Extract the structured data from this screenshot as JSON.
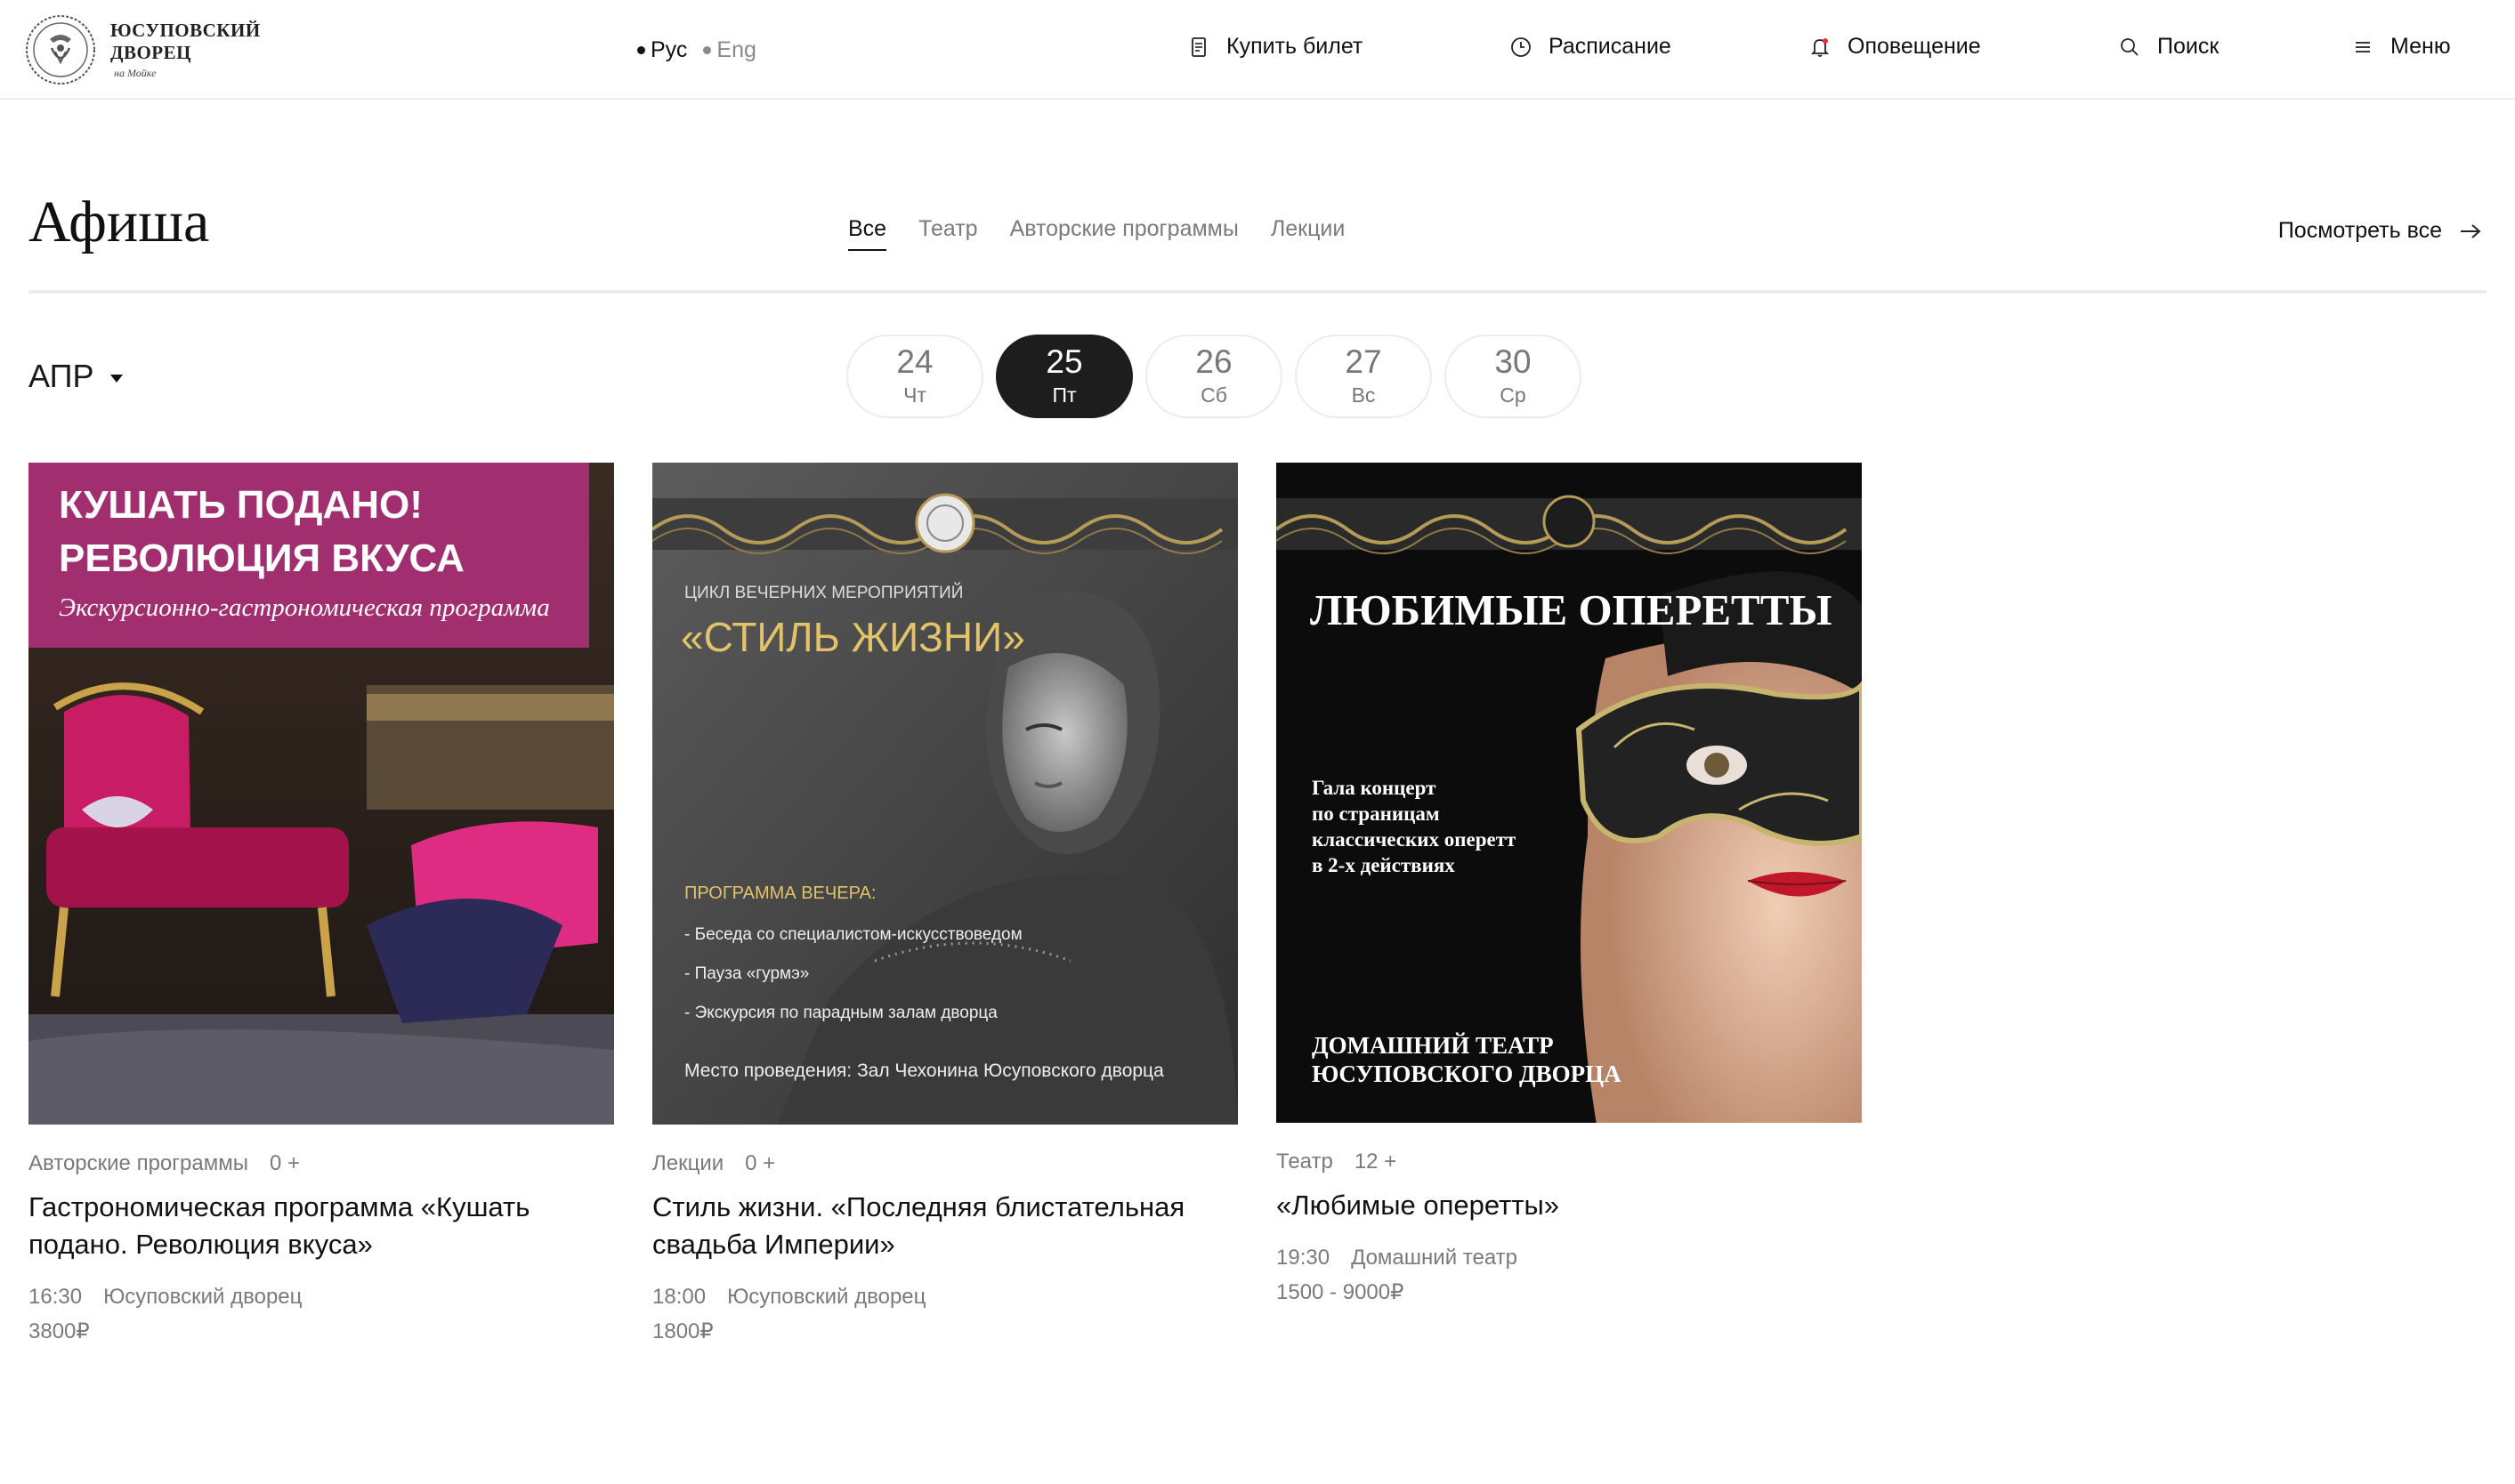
{
  "header": {
    "logo": {
      "line1": "ЮСУПОВСКИЙ",
      "line2": "ДВОРЕЦ",
      "sub": "на Мойке"
    },
    "languages": [
      {
        "label": "Рус",
        "active": true
      },
      {
        "label": "Eng",
        "active": false
      }
    ],
    "nav": [
      {
        "label": "Купить билет",
        "icon": "ticket-icon"
      },
      {
        "label": "Расписание",
        "icon": "clock-icon"
      },
      {
        "label": "Оповещение",
        "icon": "bell-icon"
      },
      {
        "label": "Поиск",
        "icon": "search-icon"
      },
      {
        "label": "Меню",
        "icon": "menu-icon"
      }
    ]
  },
  "afisha": {
    "title": "Афиша",
    "tabs": [
      {
        "label": "Все",
        "active": true
      },
      {
        "label": "Театр",
        "active": false
      },
      {
        "label": "Авторские программы",
        "active": false
      },
      {
        "label": "Лекции",
        "active": false
      }
    ],
    "view_all": "Посмотреть все"
  },
  "calendar": {
    "month": "АПР",
    "dates": [
      {
        "day": "24",
        "weekday": "Чт",
        "active": false
      },
      {
        "day": "25",
        "weekday": "Пт",
        "active": true
      },
      {
        "day": "26",
        "weekday": "Сб",
        "active": false
      },
      {
        "day": "27",
        "weekday": "Вс",
        "active": false
      },
      {
        "day": "30",
        "weekday": "Ср",
        "active": false
      }
    ]
  },
  "events": [
    {
      "category": "Авторские программы",
      "age": "0 +",
      "title": "Гастрономическая программа «Кушать подано. Революция вкуса»",
      "time": "16:30",
      "place": "Юсуповский дворец",
      "price": "3800₽",
      "poster": {
        "line1": "КУШАТЬ ПОДАНО!",
        "line2": "РЕВОЛЮЦИЯ ВКУСА",
        "line3": "Экскурсионно-гастрономическая программа"
      }
    },
    {
      "category": "Лекции",
      "age": "0 +",
      "title": "Стиль жизни. «Последняя блистательная свадьба Империи»",
      "time": "18:00",
      "place": "Юсуповский дворец",
      "price": "1800₽",
      "poster": {
        "series": "ЦИКЛ ВЕЧЕРНИХ МЕРОПРИЯТИЙ",
        "name": "«СТИЛЬ ЖИЗНИ»",
        "program_title": "ПРОГРАММА ВЕЧЕРА:",
        "items": [
          "- Беседа со специалистом-искусствоведом",
          "- Пауза «гурмэ»",
          "- Экскурсия по парадным залам дворца"
        ],
        "venue": "Место проведения: Зал Чехонина Юсуповского дворца"
      }
    },
    {
      "category": "Театр",
      "age": "12 +",
      "title": "«Любимые оперетты»",
      "time": "19:30",
      "place": "Домашний театр",
      "price": "1500 - 9000₽",
      "poster": {
        "title": "ЛЮБИМЫЕ ОПЕРЕТТЫ",
        "desc": [
          "Гала концерт",
          "по страницам",
          "классических оперетт",
          "в 2-х действиях"
        ],
        "footer": [
          "ДОМАШНИЙ ТЕАТР",
          "ЮСУПОВСКОГО ДВОРЦА"
        ]
      }
    }
  ]
}
